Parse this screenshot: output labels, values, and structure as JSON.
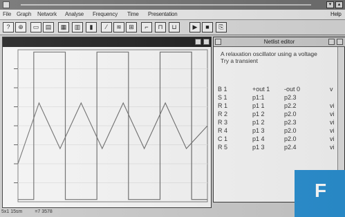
{
  "menu": {
    "items": [
      "File",
      "Graph",
      "Network",
      "Analyse",
      "Frequency",
      "Time",
      "Presentation"
    ],
    "help": "Help"
  },
  "toolbar": {
    "icons": [
      "help-icon",
      "zoom-icon",
      "open-icon",
      "print-icon",
      "grid-icon",
      "scale-icon",
      "cursor-icon",
      "waveform-icon",
      "chart-icon",
      "pulse-icon",
      "step-icon",
      "play-icon",
      "pause-icon",
      "stop-icon",
      "copy-icon"
    ]
  },
  "graph": {
    "status_left": "5x1 15sm",
    "status_right": "=7 3578",
    "colors": {
      "square": "#6a6a6a",
      "triangle": "#6a6a6a",
      "background": "#f3f3f3"
    }
  },
  "chart_data": {
    "type": "line",
    "series": [
      {
        "values": [
          0,
          1,
          1,
          0,
          0,
          1,
          1,
          0,
          0,
          1,
          1,
          0,
          0
        ]
      },
      {
        "values": [
          0.25,
          0.65,
          0.35,
          0.65,
          0.35,
          0.65,
          0.35,
          0.65,
          0.35,
          0.5
        ]
      }
    ],
    "grid": true
  },
  "netlist": {
    "title": "Netlist editor",
    "comment": [
      "A relaxation oscillator using a voltage",
      "Try a transient"
    ],
    "rows": [
      {
        "name": "B 1",
        "n1": "+out 1",
        "n2": "-out 0",
        "v": "v"
      },
      {
        "name": "S 1",
        "n1": "p1:1",
        "n2": "p2.3",
        "v": ""
      },
      {
        "name": "R 1",
        "n1": "p1 1",
        "n2": "p2.2",
        "v": "vi"
      },
      {
        "name": "R 2",
        "n1": "p1 2",
        "n2": "p2.0",
        "v": "vi"
      },
      {
        "name": "R 3",
        "n1": "p1 2",
        "n2": "p2.3",
        "v": "vi"
      },
      {
        "name": "R 4",
        "n1": "p1 3",
        "n2": "p2.0",
        "v": "vi"
      },
      {
        "name": "C 1",
        "n1": "p1 4",
        "n2": "p2.0",
        "v": "vi"
      },
      {
        "name": "R 5",
        "n1": "p1 3",
        "n2": "p2.4",
        "v": "vi"
      }
    ]
  },
  "corner_label": "F"
}
